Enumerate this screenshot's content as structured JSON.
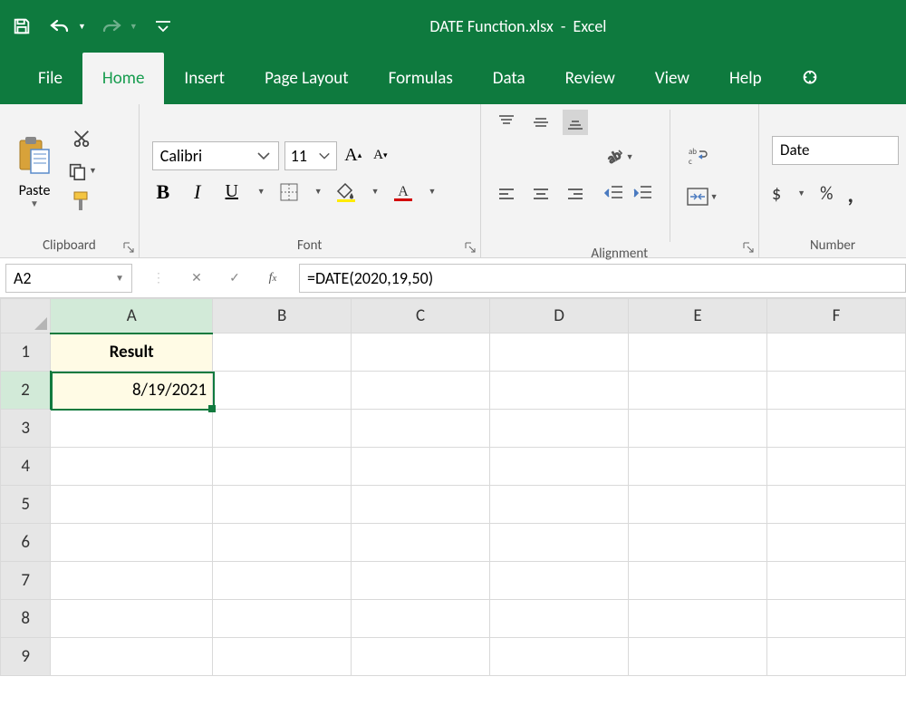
{
  "title": {
    "filename": "DATE Function.xlsx",
    "sep": "-",
    "app": "Excel"
  },
  "tabs": {
    "file": "File",
    "home": "Home",
    "insert": "Insert",
    "pagelayout": "Page Layout",
    "formulas": "Formulas",
    "data": "Data",
    "review": "Review",
    "view": "View",
    "help": "Help"
  },
  "ribbon": {
    "clipboard": {
      "paste": "Paste",
      "label": "Clipboard"
    },
    "font": {
      "name": "Calibri",
      "size": "11",
      "label": "Font"
    },
    "alignment": {
      "label": "Alignment"
    },
    "number": {
      "format": "Date",
      "label": "Number"
    }
  },
  "namebox": "A2",
  "formula": "=DATE(2020,19,50)",
  "columns": [
    "A",
    "B",
    "C",
    "D",
    "E",
    "F"
  ],
  "rows": [
    "1",
    "2",
    "3",
    "4",
    "5",
    "6",
    "7",
    "8",
    "9"
  ],
  "cells": {
    "A1": "Result",
    "A2": "8/19/2021"
  }
}
